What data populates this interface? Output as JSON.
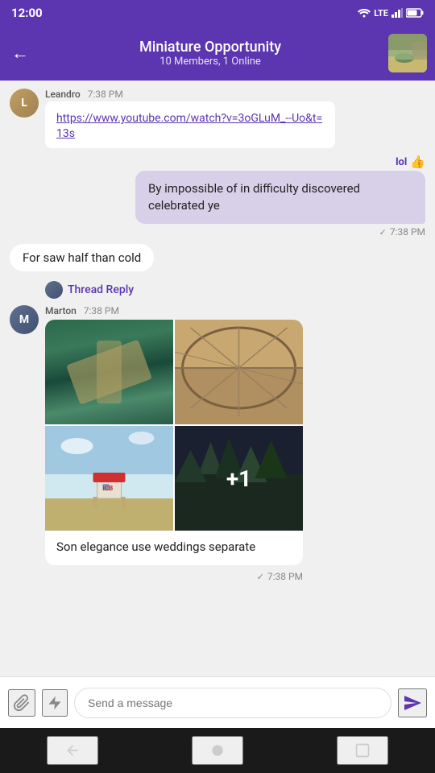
{
  "statusBar": {
    "time": "12:00",
    "icons": "▼ LTE▲ 🔋"
  },
  "header": {
    "title": "Miniature Opportunity",
    "subtitle": "10 Members, 1 Online",
    "backLabel": "←"
  },
  "messages": [
    {
      "id": "msg-link",
      "type": "incoming",
      "sender": "Leandro",
      "time": "7:38 PM",
      "content": "https://www.youtube.com/watch?v=3oGLuM_--Uo&t=13s",
      "isLink": true
    },
    {
      "id": "msg-out1",
      "type": "outgoing",
      "time": "7:38 PM",
      "reactions": [
        "lol",
        "👍"
      ],
      "content": "By impossible of in difficulty discovered celebrated ye"
    },
    {
      "id": "msg-short",
      "type": "incoming-short",
      "content": "For saw half than cold"
    },
    {
      "id": "msg-thread",
      "type": "thread-reply",
      "label": "Thread Reply"
    },
    {
      "id": "msg-marton",
      "type": "incoming-media",
      "sender": "Marton",
      "time": "7:38 PM",
      "caption": "Son elegance use weddings separate",
      "extraCount": "+1"
    }
  ],
  "outgoing2": {
    "time": "7:38 PM"
  },
  "inputBar": {
    "placeholder": "Send a message"
  },
  "reactions": {
    "lol": "lol",
    "thumb": "👍"
  }
}
